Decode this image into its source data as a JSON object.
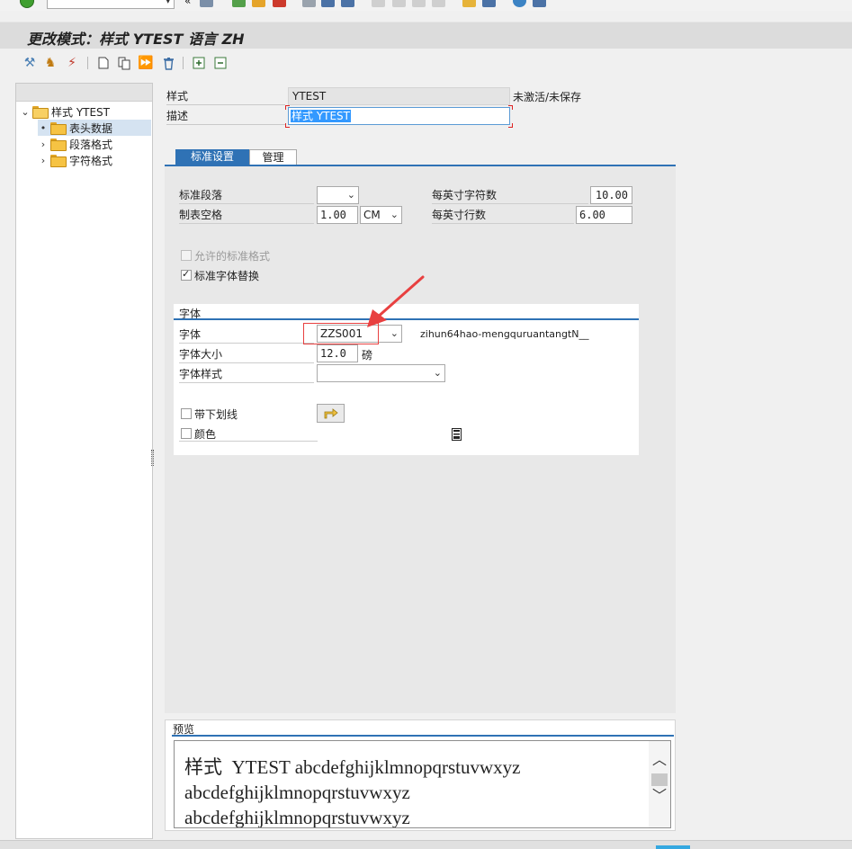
{
  "window": {
    "title": "更改模式：样式 YTEST 语言 ZH"
  },
  "system_toolbar": {
    "command_value": "",
    "more_glyph": "«"
  },
  "app_toolbar": {
    "buttons": [
      "tools-icon",
      "hierarchy-icon",
      "magic-wand-icon",
      "new-document-icon",
      "copy-document-icon",
      "multi-forward-icon",
      "delete-icon",
      "expand-icon",
      "collapse-icon"
    ]
  },
  "tree": {
    "root": {
      "label": "样式 YTEST",
      "expander": "⌄"
    },
    "items": [
      {
        "label": "表头数据",
        "expander": "•"
      },
      {
        "label": "段落格式",
        "expander": "›"
      },
      {
        "label": "字符格式",
        "expander": "›"
      }
    ]
  },
  "header": {
    "style_label": "样式",
    "style_value": "YTEST",
    "status": "未激活/未保存",
    "desc_label": "描述",
    "desc_value": "样式 YTEST"
  },
  "tabs": [
    {
      "label": "标准设置",
      "active": true
    },
    {
      "label": "管理",
      "active": false
    }
  ],
  "standard": {
    "std_paragraph_label": "标准段落",
    "std_paragraph_value": "",
    "tab_stop_label": "制表空格",
    "tab_stop_value": "1.00",
    "tab_stop_unit": "CM",
    "cpi_label": "每英寸字符数",
    "cpi_value": "10.00",
    "lpi_label": "每英寸行数",
    "lpi_value": "6.00",
    "allowed_std_formats": "允许的标准格式",
    "std_font_substitution": "标准字体替换"
  },
  "font": {
    "group_title": "字体",
    "family_label": "字体",
    "family_value": "ZZS001",
    "family_description": "zihun64hao-mengquruantangtN__",
    "size_label": "字体大小",
    "size_value": "12.0",
    "size_unit": "磅",
    "style_label": "字体样式",
    "style_value": "",
    "underline_label": "带下划线",
    "color_label": "颜色"
  },
  "preview": {
    "title": "预览",
    "line1": "样式  YTEST abcdefghijklmnopqrstuvwxyz",
    "line2": "abcdefghijklmnopqrstuvwxyz",
    "line3": "abcdefghijklmnopqrstuvwxyz"
  },
  "colors": {
    "accent": "#2f72b5",
    "highlight": "#e84040",
    "selection": "#3399ff"
  }
}
